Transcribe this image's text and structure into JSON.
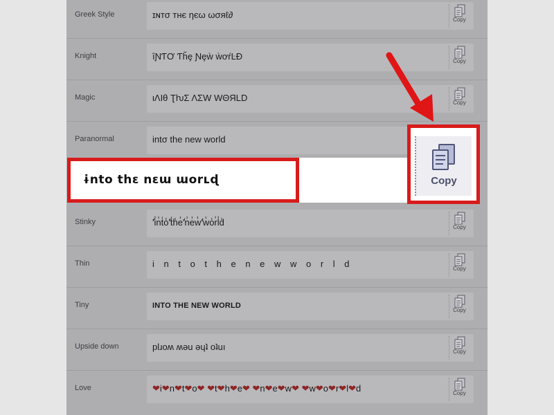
{
  "copy_label": "Copy",
  "rows": [
    {
      "label": "Greek Style",
      "text": "ɪɴтσ тнє ηєω ωσяℓ∂"
    },
    {
      "label": "Knight",
      "text": "ȋƝƬƠ Ƭȟȩ Ɲȩẁ ẁơŕĿĐ"
    },
    {
      "label": "Magic",
      "text": "ιΛΙθ ƮƕΣ ΛΣW WΘЯLD"
    },
    {
      "label": "Paranormal",
      "text": "intσ the new world"
    },
    {
      "label": "Stinky",
      "text": "'̾i̾n̾t̾o̾'̾t̾h̾e̾'̾n̾e̾w̾'̾w̾o̾r̾l̾d̾"
    },
    {
      "label": "Thin",
      "text": "i n t o  t h e  n e w w o r l d"
    },
    {
      "label": "Tiny",
      "text": "INTO THE NEW WORLD"
    },
    {
      "label": "Upside down",
      "text": "plɹoʍ ʍǝu ǝɥʇ oʇuı"
    },
    {
      "label": "Love",
      "heart": "❤",
      "letters": [
        "i",
        "n",
        "t",
        "o",
        " ",
        "t",
        "h",
        "e",
        " ",
        "n",
        "e",
        "w",
        " ",
        "w",
        "o",
        "r",
        "l",
        "d"
      ]
    }
  ],
  "highlight": {
    "text": "ɨnto thɛ nɛɯ ɯorʟɖ",
    "copy_label": "Copy"
  },
  "colors": {
    "highlight_border": "#d81b1b",
    "panel_bg": "#aeaeb1",
    "page_bg": "#e6e6e6",
    "love_heart": "#8f2424"
  },
  "icons": {
    "copy": "copy-icon",
    "arrow": "arrow-down-left-icon"
  }
}
